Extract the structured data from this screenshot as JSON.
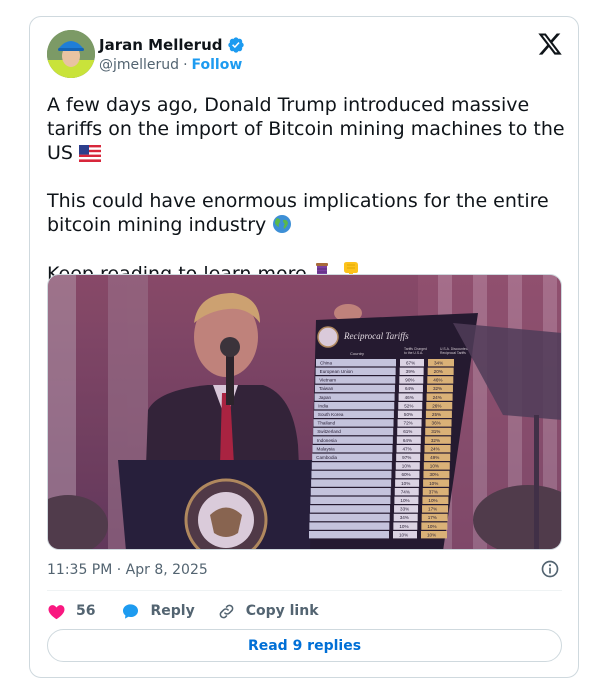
{
  "author": {
    "name": "Jaran Mellerud",
    "handle": "@jmellerud",
    "separator": "·",
    "follow_label": "Follow"
  },
  "tweet": {
    "paragraphs": [
      {
        "text": "A few days ago, Donald Trump introduced massive tariffs on the import of Bitcoin mining machines to the US",
        "emoji": "us-flag"
      },
      {
        "text": "This could have enormous implications for the entire bitcoin mining industry",
        "emoji": "globe"
      },
      {
        "text": "Keep reading to learn more",
        "emoji": "thread-and-pointing-down"
      }
    ]
  },
  "media": {
    "board_title": "Reciprocal Tariffs",
    "column_headers": [
      "Country",
      "Tariffs Charged to the U.S.A.",
      "U.S.A. Discounted Reciprocal Tariffs"
    ],
    "rows": [
      [
        "China",
        "67%",
        "34%"
      ],
      [
        "European Union",
        "39%",
        "20%"
      ],
      [
        "Vietnam",
        "90%",
        "46%"
      ],
      [
        "Taiwan",
        "64%",
        "32%"
      ],
      [
        "Japan",
        "46%",
        "24%"
      ],
      [
        "India",
        "52%",
        "26%"
      ],
      [
        "South Korea",
        "50%",
        "25%"
      ],
      [
        "Thailand",
        "72%",
        "36%"
      ],
      [
        "Switzerland",
        "61%",
        "31%"
      ],
      [
        "Indonesia",
        "64%",
        "32%"
      ],
      [
        "Malaysia",
        "47%",
        "24%"
      ],
      [
        "Cambodia",
        "97%",
        "49%"
      ],
      [
        "",
        "10%",
        "10%"
      ],
      [
        "",
        "60%",
        "30%"
      ],
      [
        "",
        "10%",
        "10%"
      ],
      [
        "",
        "74%",
        "37%"
      ],
      [
        "",
        "10%",
        "10%"
      ],
      [
        "",
        "33%",
        "17%"
      ],
      [
        "",
        "34%",
        "17%"
      ],
      [
        "",
        "10%",
        "10%"
      ],
      [
        "",
        "10%",
        "10%"
      ]
    ]
  },
  "meta": {
    "timestamp": "11:35 PM · Apr 8, 2025"
  },
  "actions": {
    "like_count": "56",
    "reply_label": "Reply",
    "copy_link_label": "Copy link"
  },
  "replies_button": "Read 9 replies",
  "colors": {
    "accent": "#1d9bf0",
    "like": "#f91880",
    "text": "#0f1419",
    "muted": "#536471",
    "border": "#cfd9de"
  }
}
